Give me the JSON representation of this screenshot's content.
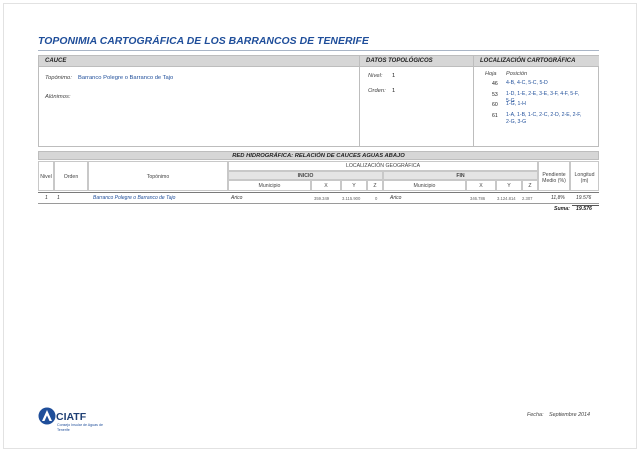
{
  "title": "TOPONIMIA CARTOGRÁFICA DE LOS BARRANCOS DE TENERIFE",
  "cauce": {
    "header": "CAUCE",
    "toponimo_label": "Topónimo:",
    "toponimo_value": "Barranco Polegre o Barranco de Tajo",
    "alonimos_label": "Alónimos:"
  },
  "datos": {
    "header": "DATOS TOPOLÓGICOS",
    "nivel_label": "Nivel:",
    "nivel_value": "1",
    "orden_label": "Orden:",
    "orden_value": "1"
  },
  "localizacion": {
    "header": "LOCALIZACIÓN CARTOGRÁFICA",
    "hoja_label": "Hoja",
    "posicion_label": "Posición",
    "rows": [
      {
        "hoja": "46",
        "posicion": "4-B, 4-C, 5-C, 5-D"
      },
      {
        "hoja": "53",
        "posicion": "1-D, 1-E, 2-E, 3-E, 3-F, 4-F, 5-F, 5-G"
      },
      {
        "hoja": "60",
        "posicion": "1-G, 1-H"
      },
      {
        "hoja": "61",
        "posicion": "1-A, 1-B, 1-C, 2-C, 2-D, 2-E, 2-F, 2-G, 3-G"
      }
    ]
  },
  "red": {
    "title": "RED HIDROGRÁFICA: RELACIÓN DE CAUCES AGUAS ABAJO",
    "headers": {
      "nivel": "Nivel",
      "orden": "Orden",
      "toponimo": "Topónimo",
      "loc_geo": "LOCALIZACIÓN GEOGRÁFICA",
      "inicio": "INICIO",
      "fin": "FIN",
      "municipio": "Municipio",
      "x": "X",
      "y": "Y",
      "z": "Z",
      "pendiente": "Pendiente Medio (%)",
      "longitud": "Longitud (m)"
    },
    "row": {
      "nivel": "1",
      "orden": "1",
      "toponimo": "Barranco Polegre o Barranco de Tajo",
      "municipio_inicio": "Arico",
      "x_inicio": "359.349",
      "y_inicio": "3.115.900",
      "z_inicio": "0",
      "municipio_fin": "Arico",
      "x_fin": "346.786",
      "y_fin": "3.124.814",
      "z_fin": "2.307",
      "pendiente": "11,8%",
      "longitud": "19.576"
    },
    "suma_label": "Suma:",
    "suma_value": "19.576"
  },
  "footer": {
    "logo_text": "CIATF",
    "logo_subtext": "Consejo Insular de Aguas de Tenerife",
    "fecha_label": "Fecha:",
    "fecha_value": "Septiembre  2014"
  },
  "colors": {
    "accent": "#1f4e9a",
    "header_bg": "#d6d6d6"
  }
}
